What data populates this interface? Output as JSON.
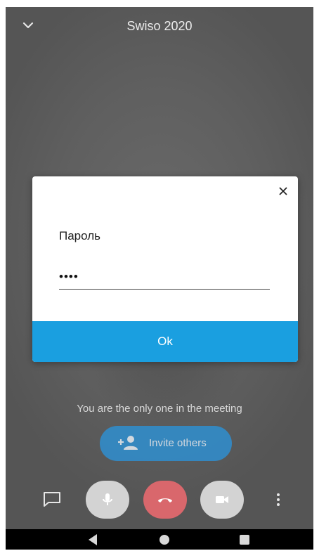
{
  "header": {
    "title": "Swiso 2020",
    "collapse_icon": "chevron-down-icon"
  },
  "dialog": {
    "close_icon": "close-icon",
    "password_label": "Пароль",
    "password_value": "••••",
    "ok_label": "Ok",
    "accent_color": "#1a9fe0"
  },
  "meeting": {
    "status_text": "You are the only one in the meeting",
    "invite_label": "Invite others",
    "invite_icon": "add-person-icon"
  },
  "controls": {
    "chat_icon": "chat-icon",
    "mic_icon": "microphone-icon",
    "hangup_icon": "hangup-icon",
    "camera_icon": "video-camera-icon",
    "more_icon": "more-vertical-icon",
    "hangup_color": "#d9676c"
  },
  "navbar": {
    "back_icon": "back-icon",
    "home_icon": "home-icon",
    "recents_icon": "recents-icon"
  }
}
